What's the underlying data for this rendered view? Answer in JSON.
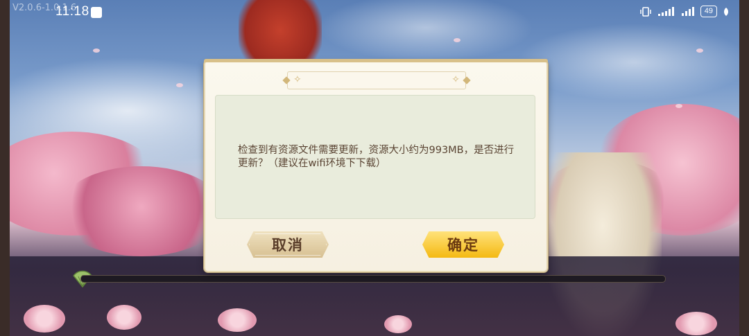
{
  "status_bar": {
    "version": "V2.0.6-1.0.1.6",
    "time": "11:18",
    "battery": "49"
  },
  "dialog": {
    "message": "检查到有资源文件需要更新，资源大小约为993MB，是否进行更新？（建议在wifi环境下下载）",
    "cancel_label": "取消",
    "confirm_label": "确定"
  },
  "loading": {
    "progress": 0
  },
  "colors": {
    "confirm_button": "#f4b913",
    "cancel_button": "#d7c092",
    "message_text": "#5a4433"
  }
}
